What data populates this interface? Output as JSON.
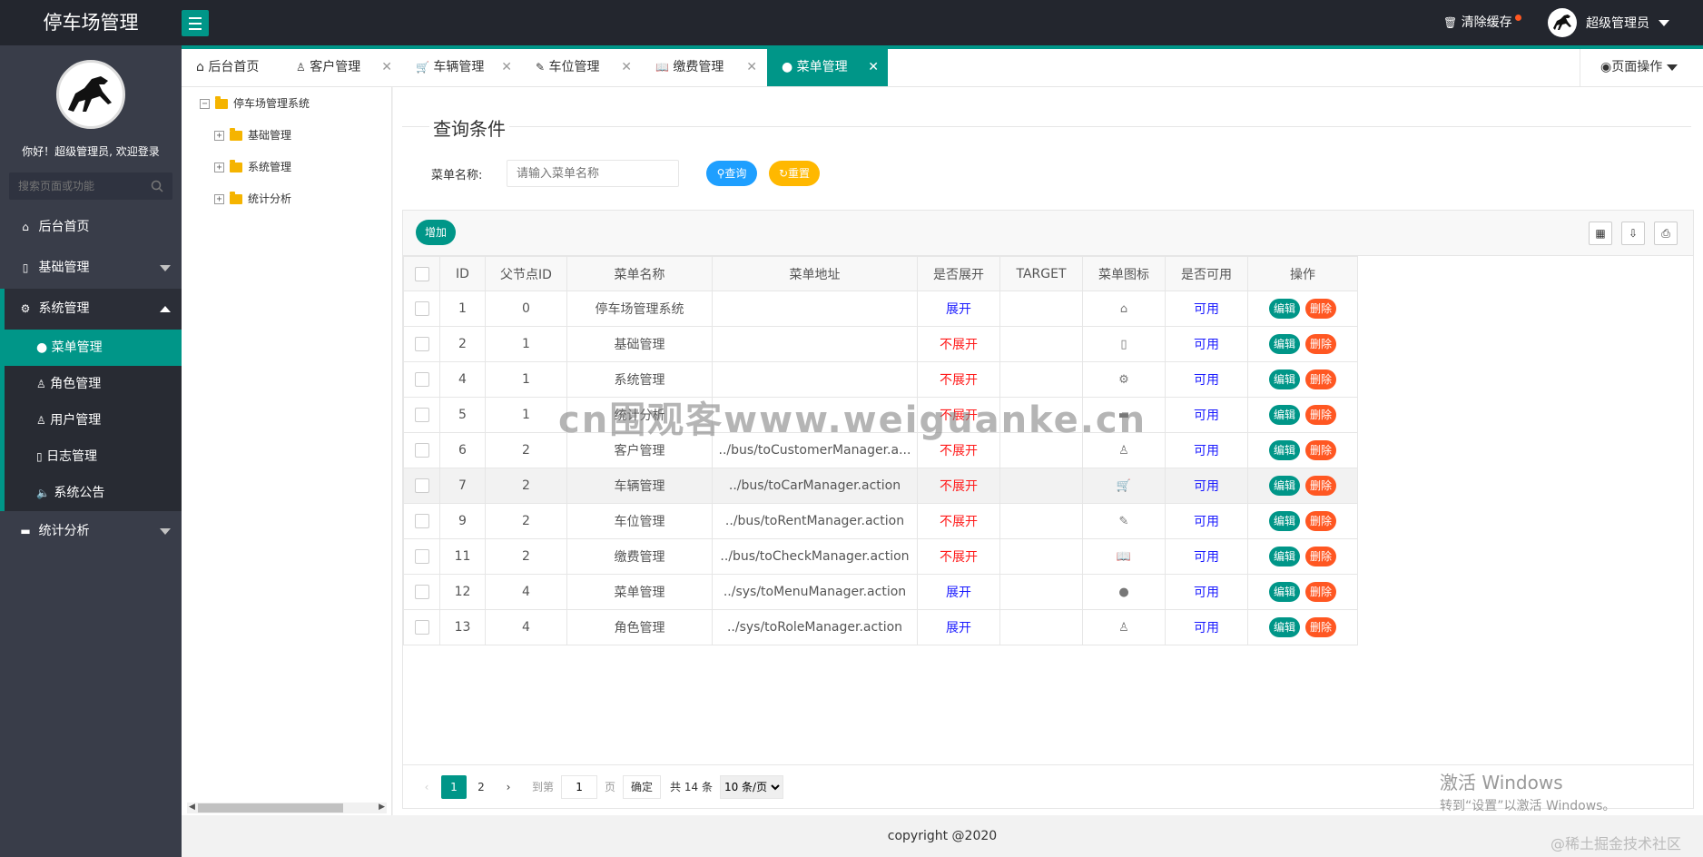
{
  "header": {
    "app_title": "停车场管理",
    "clear_cache": "清除缓存",
    "admin_name": "超级管理员"
  },
  "sidebar": {
    "welcome": "你好！超级管理员, 欢迎登录",
    "search_placeholder": "搜索页面或功能",
    "items": [
      {
        "label": "后台首页",
        "icon": "home-icon"
      },
      {
        "label": "基础管理",
        "icon": "file-icon"
      },
      {
        "label": "系统管理",
        "icon": "gear-icon"
      },
      {
        "label": "统计分析",
        "icon": "chat-icon"
      }
    ],
    "sub_items": [
      {
        "label": "菜单管理",
        "icon": "circle-icon"
      },
      {
        "label": "角色管理",
        "icon": "user-icon"
      },
      {
        "label": "用户管理",
        "icon": "users-icon"
      },
      {
        "label": "日志管理",
        "icon": "log-icon"
      },
      {
        "label": "系统公告",
        "icon": "speaker-icon"
      }
    ]
  },
  "tabs": [
    {
      "label": "后台首页",
      "icon": "home-icon"
    },
    {
      "label": "客户管理",
      "icon": "users-icon"
    },
    {
      "label": "车辆管理",
      "icon": "cart-icon"
    },
    {
      "label": "车位管理",
      "icon": "edit-doc-icon"
    },
    {
      "label": "缴费管理",
      "icon": "book-icon"
    },
    {
      "label": "菜单管理",
      "icon": "circle-icon"
    }
  ],
  "page_ops": "页面操作",
  "tree": {
    "root": "停车场管理系统",
    "children": [
      "基础管理",
      "系统管理",
      "统计分析"
    ]
  },
  "query": {
    "title": "查询条件",
    "label": "菜单名称:",
    "placeholder": "请输入菜单名称",
    "search_btn": "查询",
    "reset_btn": "重置"
  },
  "table": {
    "add_btn": "增加",
    "headers": [
      "ID",
      "父节点ID",
      "菜单名称",
      "菜单地址",
      "是否展开",
      "TARGET",
      "菜单图标",
      "是否可用",
      "操作"
    ],
    "edit_label": "编辑",
    "delete_label": "删除",
    "rows": [
      {
        "id": "1",
        "pid": "0",
        "name": "停车场管理系统",
        "url": "",
        "spread": "展开",
        "spread_yes": true,
        "target": "",
        "icon": "home-icon",
        "available": "可用"
      },
      {
        "id": "2",
        "pid": "1",
        "name": "基础管理",
        "url": "",
        "spread": "不展开",
        "spread_yes": false,
        "target": "",
        "icon": "file-icon",
        "available": "可用"
      },
      {
        "id": "4",
        "pid": "1",
        "name": "系统管理",
        "url": "",
        "spread": "不展开",
        "spread_yes": false,
        "target": "",
        "icon": "gear-icon",
        "available": "可用"
      },
      {
        "id": "5",
        "pid": "1",
        "name": "统计分析",
        "url": "",
        "spread": "不展开",
        "spread_yes": false,
        "target": "",
        "icon": "chat-icon",
        "available": "可用"
      },
      {
        "id": "6",
        "pid": "2",
        "name": "客户管理",
        "url": "../bus/toCustomerManager.a...",
        "spread": "不展开",
        "spread_yes": false,
        "target": "",
        "icon": "users-icon",
        "available": "可用"
      },
      {
        "id": "7",
        "pid": "2",
        "name": "车辆管理",
        "url": "../bus/toCarManager.action",
        "spread": "不展开",
        "spread_yes": false,
        "target": "",
        "icon": "cart-icon",
        "available": "可用"
      },
      {
        "id": "9",
        "pid": "2",
        "name": "车位管理",
        "url": "../bus/toRentManager.action",
        "spread": "不展开",
        "spread_yes": false,
        "target": "",
        "icon": "edit-doc-icon",
        "available": "可用"
      },
      {
        "id": "11",
        "pid": "2",
        "name": "缴费管理",
        "url": "../bus/toCheckManager.action",
        "spread": "不展开",
        "spread_yes": false,
        "target": "",
        "icon": "book-icon",
        "available": "可用"
      },
      {
        "id": "12",
        "pid": "4",
        "name": "菜单管理",
        "url": "../sys/toMenuManager.action",
        "spread": "展开",
        "spread_yes": true,
        "target": "",
        "icon": "circle-icon",
        "available": "可用"
      },
      {
        "id": "13",
        "pid": "4",
        "name": "角色管理",
        "url": "../sys/toRoleManager.action",
        "spread": "展开",
        "spread_yes": true,
        "target": "",
        "icon": "user-icon",
        "available": "可用"
      }
    ]
  },
  "pager": {
    "pages": [
      "1",
      "2"
    ],
    "goto_label": "到第",
    "goto_value": "1",
    "page_unit": "页",
    "confirm": "确定",
    "total": "共 14 条",
    "page_size": "10 条/页"
  },
  "footer": "copyright @2020",
  "overlay": {
    "watermark": "cn围观客www.weiguanke.cn",
    "activate_title": "激活 Windows",
    "activate_sub": "转到“设置”以激活 Windows。",
    "corner": "@稀土掘金技术社区"
  }
}
